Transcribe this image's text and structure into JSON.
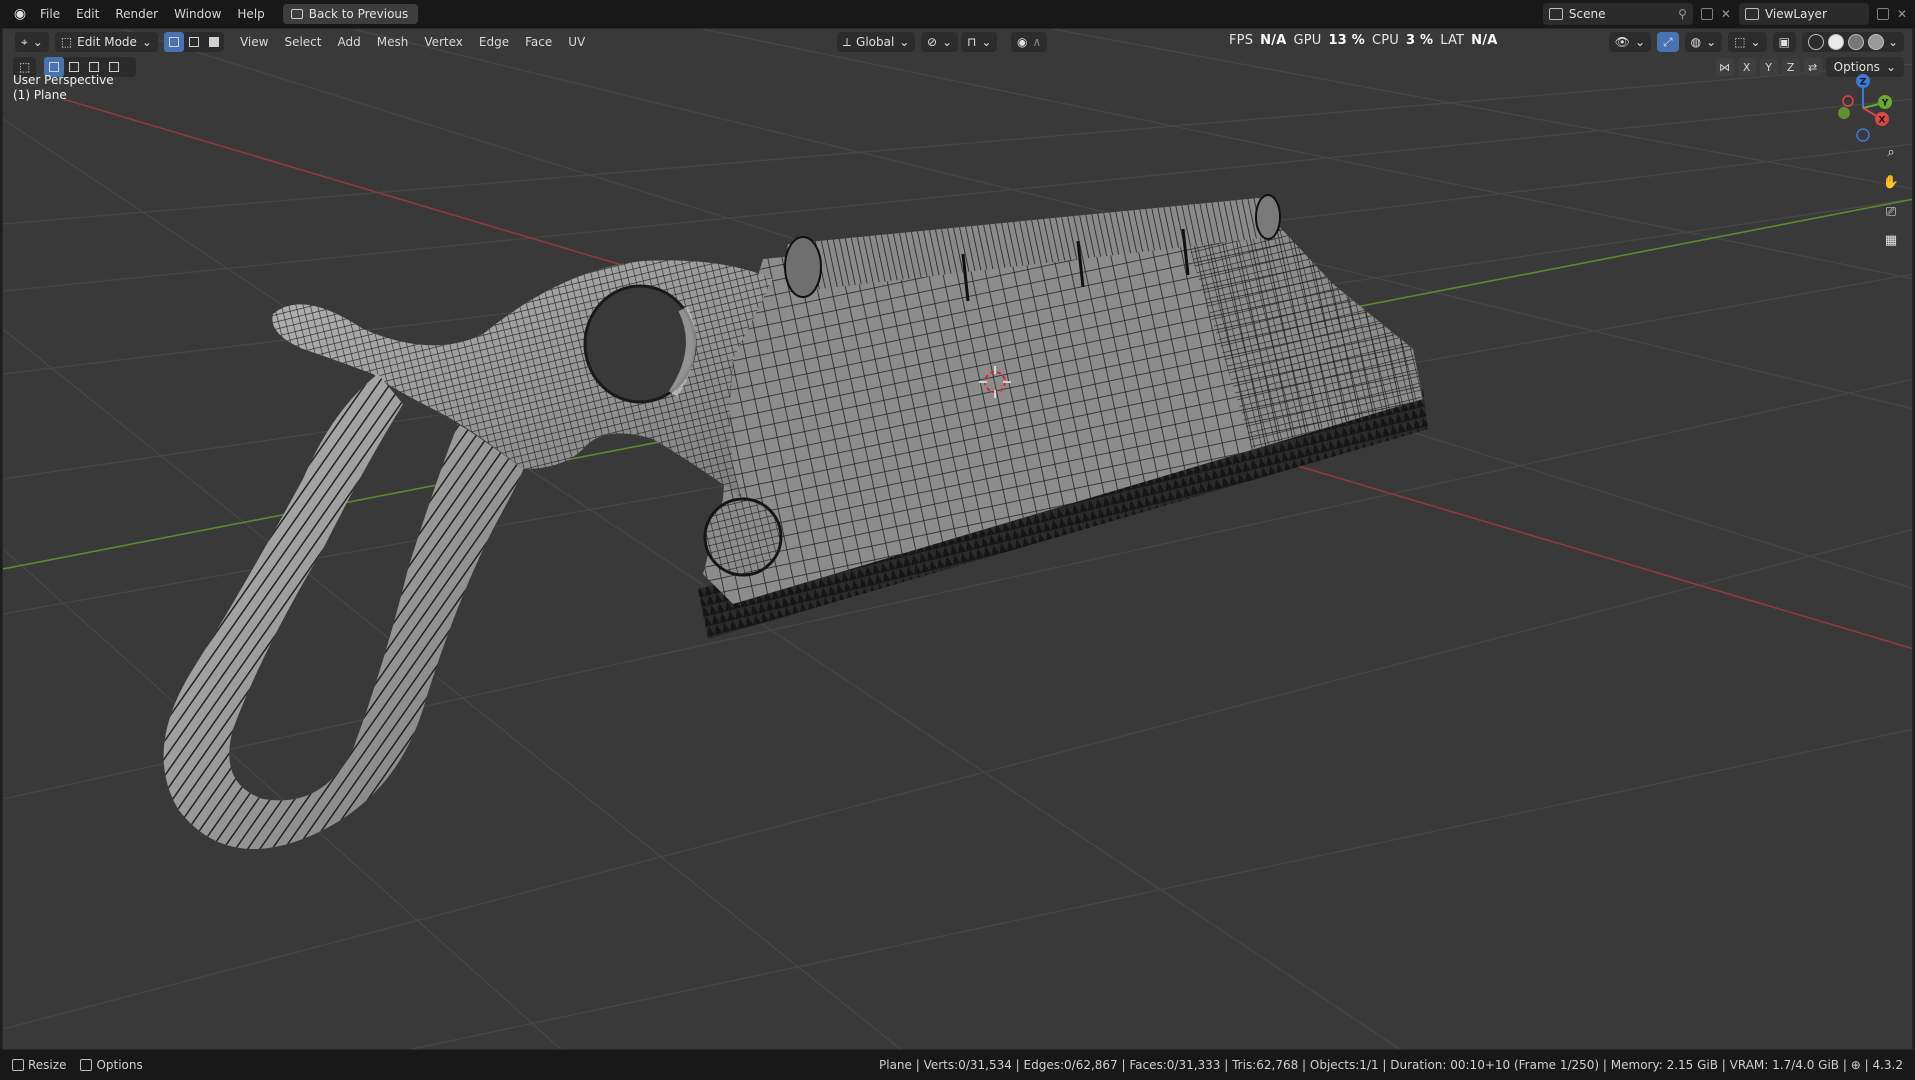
{
  "topbar": {
    "menus": [
      "File",
      "Edit",
      "Render",
      "Window",
      "Help"
    ],
    "back_button": "Back to Previous",
    "scene": "Scene",
    "view_layer": "ViewLayer"
  },
  "viewport_header": {
    "mode": "Edit Mode",
    "menus": [
      "View",
      "Select",
      "Add",
      "Mesh",
      "Vertex",
      "Edge",
      "Face",
      "UV"
    ],
    "orientation": "Global",
    "axes": [
      "X",
      "Y",
      "Z"
    ],
    "options_label": "Options"
  },
  "stats": {
    "fps_label": "FPS",
    "fps_value": "N/A",
    "gpu_label": "GPU",
    "gpu_value": "13 %",
    "cpu_label": "CPU",
    "cpu_value": "3 %",
    "lat_label": "LAT",
    "lat_value": "N/A"
  },
  "overlay": {
    "view_name": "User Perspective",
    "object_name": "(1) Plane"
  },
  "gizmo": {
    "x": "X",
    "y": "Y",
    "z": "Z"
  },
  "statusbar": {
    "left": [
      "Resize",
      "Options"
    ],
    "info": "Plane | Verts:0/31,534 | Edges:0/62,867 | Faces:0/31,333 | Tris:62,768 | Objects:1/1 | Duration: 00:10+10 (Frame 1/250) | Memory: 2.15 GiB | VRAM: 1.7/4.0 GiB | ",
    "version": "4.3.2"
  },
  "colors": {
    "viewport_bg": "#393939",
    "grid": "#4a4a4a",
    "x_axis": "#9c3a3a",
    "y_axis": "#5c8a2e",
    "selection_blue": "#4772b3",
    "mesh_fill": "#8f8f8f",
    "wire": "#1a1a1a"
  }
}
